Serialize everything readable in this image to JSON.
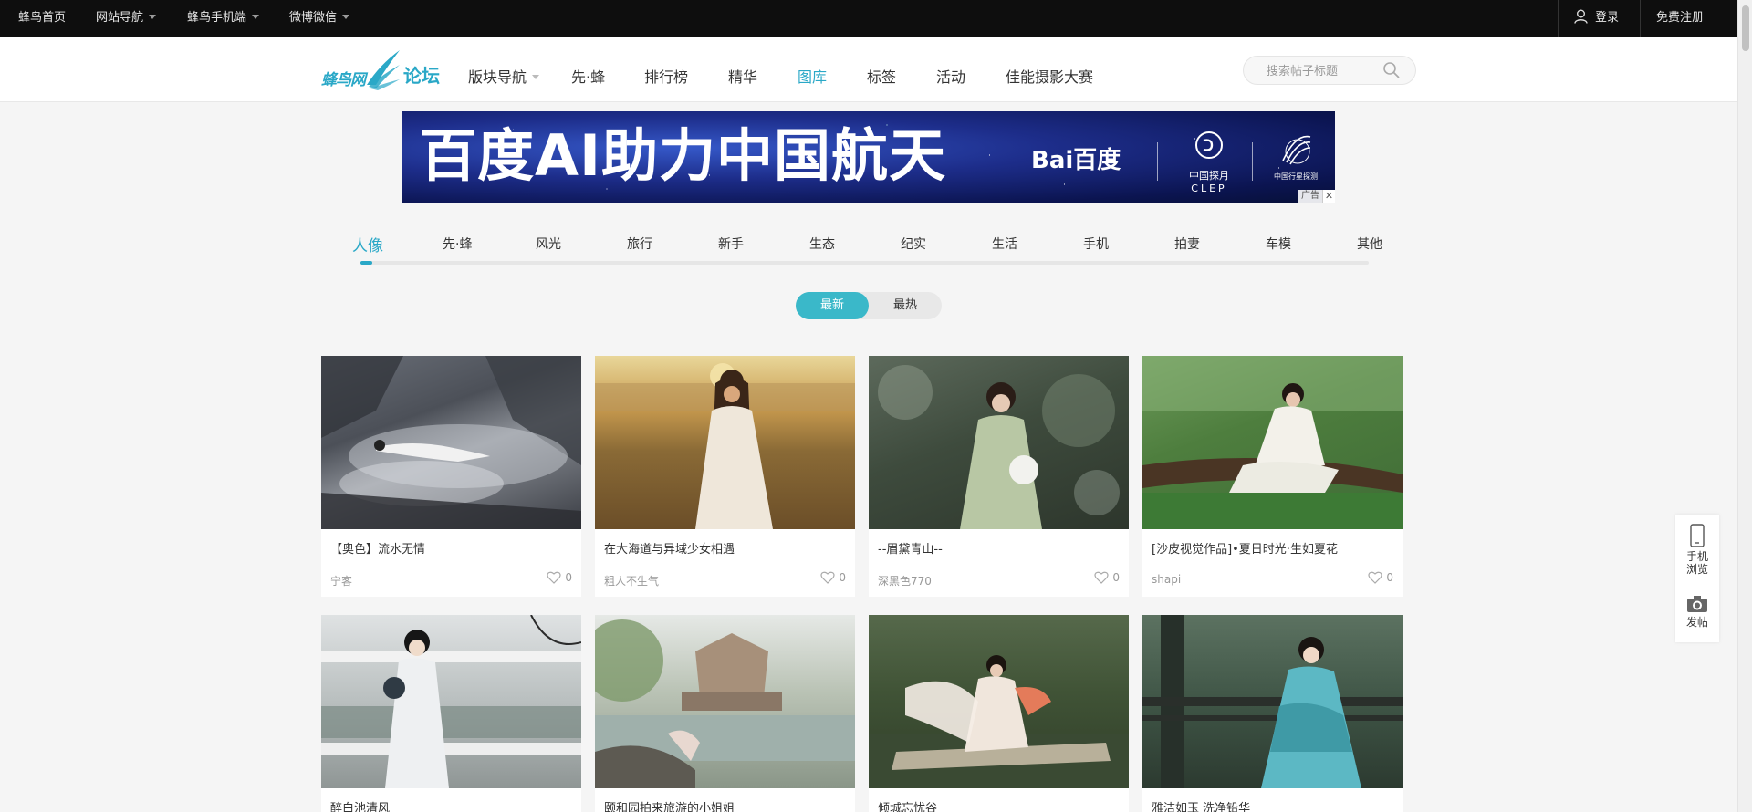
{
  "topbar": {
    "home": "蜂鸟首页",
    "site_nav": "网站导航",
    "mobile": "蜂鸟手机端",
    "weibo": "微博微信",
    "login": "登录",
    "register": "免费注册"
  },
  "header": {
    "logo_text": "蜂鸟网",
    "logo_luntan": "论坛",
    "nav": [
      "版块导航",
      "先·蜂",
      "排行榜",
      "精华",
      "图库",
      "标签",
      "活动",
      "佳能摄影大赛"
    ],
    "active_nav": "图库",
    "search_placeholder": "搜索帖子标题"
  },
  "banner": {
    "headline": "百度AI助力中国航天",
    "brand": "Bai百度",
    "clep_cn": "中国探月",
    "clep_en": "CLEP",
    "cnsa": "中国行星探测",
    "ad_label": "广告",
    "close": "✕"
  },
  "categories": [
    "人像",
    "先·蜂",
    "风光",
    "旅行",
    "新手",
    "生态",
    "纪实",
    "生活",
    "手机",
    "拍妻",
    "车模",
    "其他"
  ],
  "active_category": "人像",
  "sort": {
    "newest": "最新",
    "hottest": "最热"
  },
  "cards": [
    {
      "title": "【奥色】流水无情",
      "author": "宁客",
      "likes": "0"
    },
    {
      "title": "在大海道与异域少女相遇",
      "author": "粗人不生气",
      "likes": "0"
    },
    {
      "title": "--眉黛青山--",
      "author": "深黑色770",
      "likes": "0"
    },
    {
      "title": "[沙皮视觉作品]•夏日时光·生如夏花",
      "author": "shapi",
      "likes": "0"
    },
    {
      "title": "醉白池清风",
      "author": "",
      "likes": ""
    },
    {
      "title": "颐和园拍来旅游的小姐姐",
      "author": "",
      "likes": ""
    },
    {
      "title": "倾城忘忧谷",
      "author": "",
      "likes": ""
    },
    {
      "title": "雅洁如玉 洗净铅华",
      "author": "",
      "likes": ""
    }
  ],
  "float": {
    "mobile_browse_1": "手机",
    "mobile_browse_2": "浏览",
    "post": "发帖"
  },
  "colors": {
    "accent": "#2aa8c7",
    "topbar": "#0e0e0e",
    "sort_active": "#3ab8c9"
  }
}
